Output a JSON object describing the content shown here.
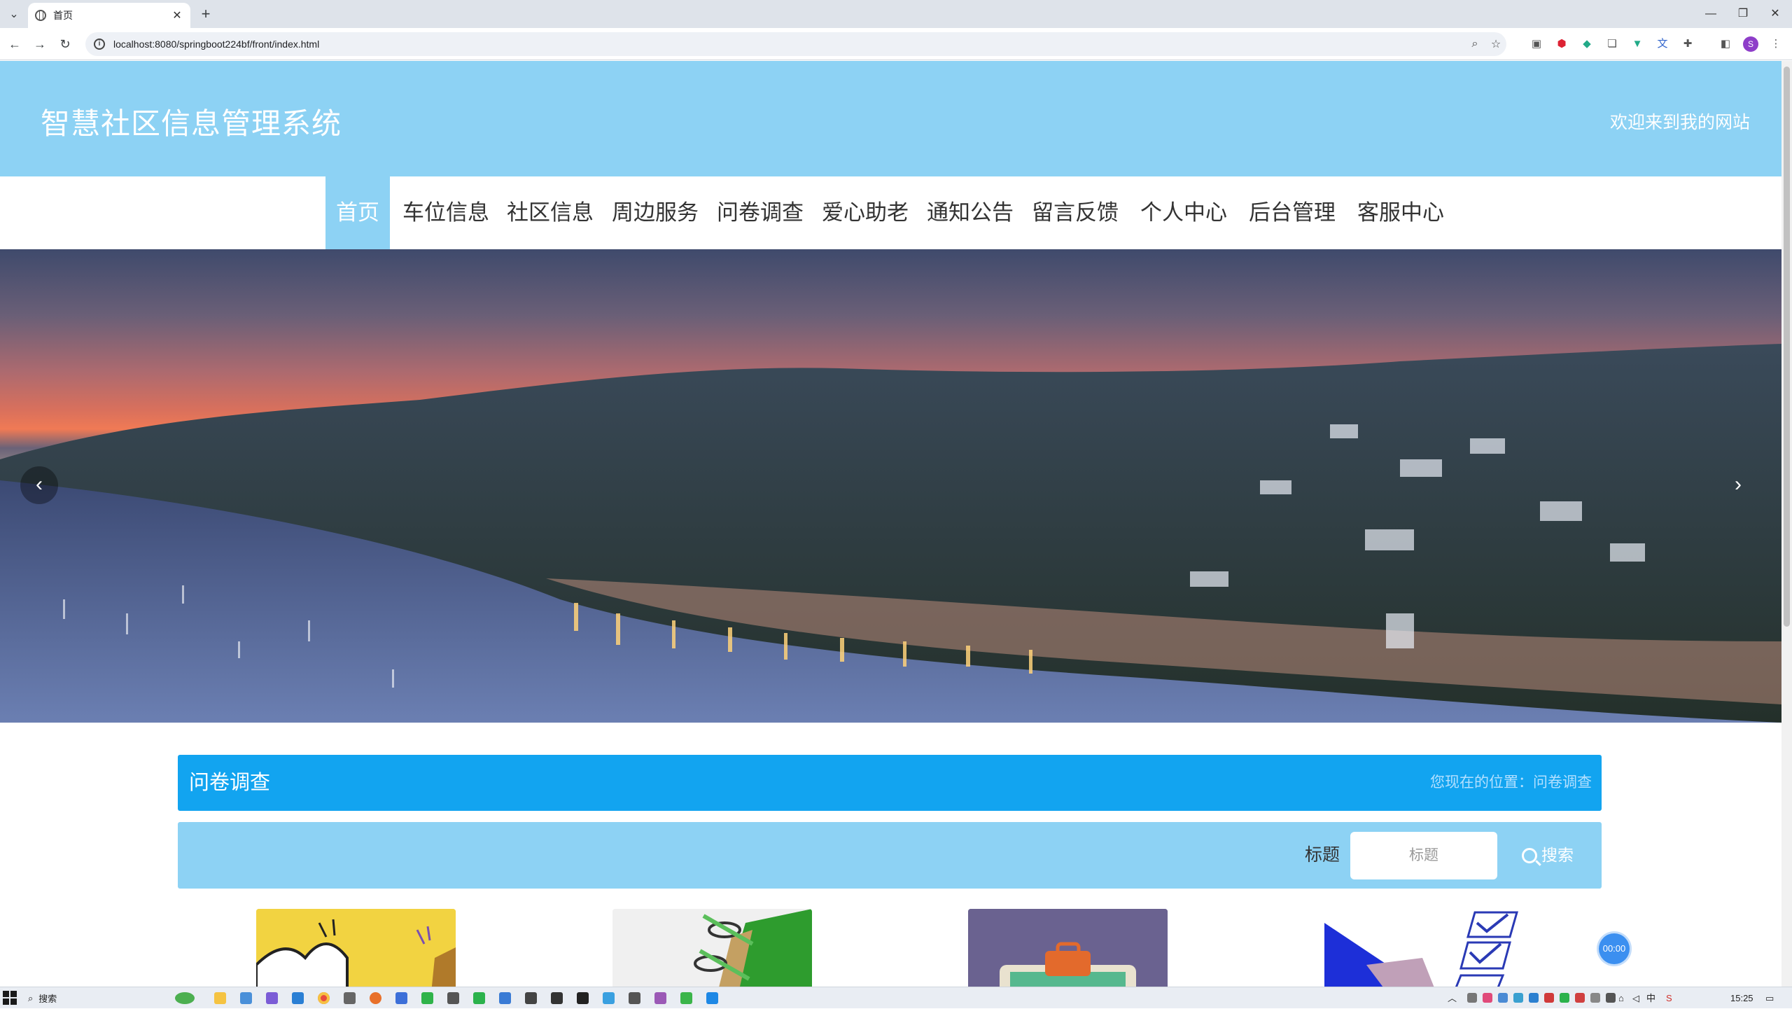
{
  "browser": {
    "tab_title": "首页",
    "url": "localhost:8080/springboot224bf/front/index.html",
    "profile_initial": "S"
  },
  "site": {
    "title": "智慧社区信息管理系统",
    "welcome": "欢迎来到我的网站"
  },
  "nav": {
    "items": [
      "首页",
      "车位信息",
      "社区信息",
      "周边服务",
      "问卷调查",
      "爱心助老",
      "通知公告",
      "留言反馈",
      "个人中心",
      "后台管理",
      "客服中心"
    ],
    "active_index": 0
  },
  "banner": {
    "slide_count": 3,
    "active_slide": 0
  },
  "section": {
    "title": "问卷调查",
    "breadcrumb": "您现在的位置：问卷调查"
  },
  "search": {
    "label": "标题",
    "placeholder": "标题",
    "button_label": "搜索"
  },
  "timer": {
    "value": "00:00"
  },
  "taskbar": {
    "search_label": "搜索",
    "ime": "中",
    "time": "15:25"
  },
  "colors": {
    "header_bg": "#8dd2f4",
    "section_head_bg": "#12a4f0",
    "nav_active_bg": "#8dd2f4"
  }
}
